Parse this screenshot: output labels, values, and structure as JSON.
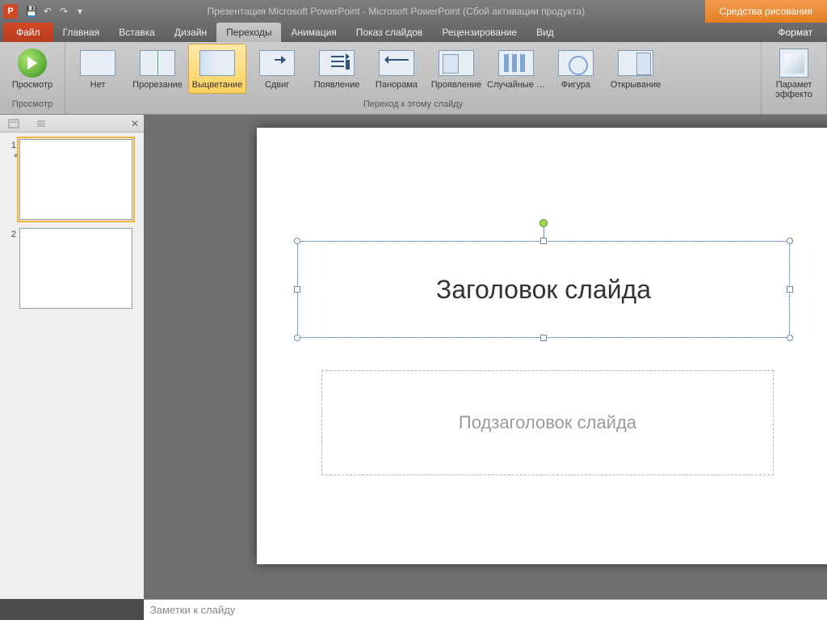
{
  "titleBar": {
    "text": "Презентация Microsoft PowerPoint  -  Microsoft PowerPoint (Сбой активации продукта)",
    "contextTab": "Средства рисования"
  },
  "tabs": {
    "file": "Файл",
    "items": [
      "Главная",
      "Вставка",
      "Дизайн",
      "Переходы",
      "Анимация",
      "Показ слайдов",
      "Рецензирование",
      "Вид"
    ],
    "activeIndex": 3,
    "contextItem": "Формат"
  },
  "ribbon": {
    "group1Label": "Просмотр",
    "group2Label": "Переход к этому слайду",
    "preview": "Просмотр",
    "transitions": [
      {
        "label": "Нет",
        "icon": "ico-none"
      },
      {
        "label": "Прорезание",
        "icon": "ico-cut"
      },
      {
        "label": "Выцветание",
        "icon": "ico-fade",
        "selected": true
      },
      {
        "label": "Сдвиг",
        "icon": "ico-shift"
      },
      {
        "label": "Появление",
        "icon": "ico-appear"
      },
      {
        "label": "Панорама",
        "icon": "ico-panorama"
      },
      {
        "label": "Проявление",
        "icon": "ico-reveal"
      },
      {
        "label": "Случайные …",
        "icon": "ico-random"
      },
      {
        "label": "Фигура",
        "icon": "ico-shape"
      },
      {
        "label": "Открывание",
        "icon": "ico-uncover"
      }
    ],
    "effectOptions": "Парамет\nэффекто"
  },
  "slidePanel": {
    "slides": [
      {
        "num": "1",
        "selected": true,
        "hasTransition": true
      },
      {
        "num": "2"
      }
    ]
  },
  "slide": {
    "title": "Заголовок слайда",
    "subtitle": "Подзаголовок слайда"
  },
  "notes": {
    "placeholder": "Заметки к слайду"
  }
}
